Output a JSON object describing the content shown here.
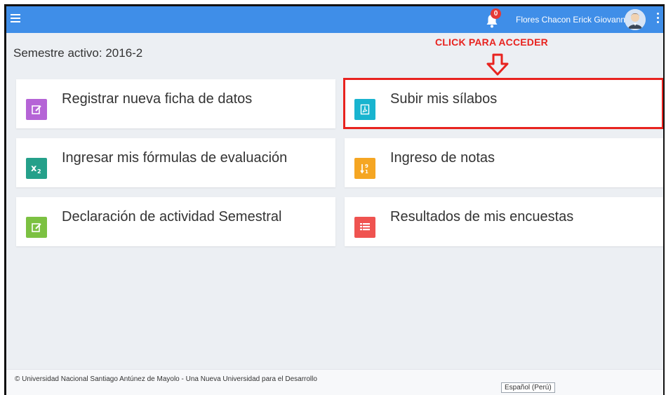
{
  "header": {
    "notifications_count": "0",
    "user_name": "Flores Chacon Erick Giovanny",
    "icons": [
      "menu-icon",
      "bell-icon",
      "avatar",
      "more-vert-icon"
    ],
    "color": "#3f8ee8"
  },
  "main": {
    "semester_label": "Semestre activo: 2016-2",
    "annotation": {
      "text": "CLICK PARA ACCEDER",
      "color": "#e8231f"
    },
    "cards": [
      {
        "label": "Registrar nueva ficha de datos",
        "icon": "edit-icon",
        "color": "#b564d6"
      },
      {
        "label": "Subir mis sílabos",
        "icon": "pdf-icon",
        "color": "#19b4cf"
      },
      {
        "label": "Ingresar mis fórmulas de evaluación",
        "icon": "subscript-icon",
        "color": "#25a08a"
      },
      {
        "label": "Ingreso de notas",
        "icon": "sort-numeric-icon",
        "color": "#f5a623"
      },
      {
        "label": "Declaración de actividad Semestral",
        "icon": "edit-icon",
        "color": "#7cc142"
      },
      {
        "label": "Resultados de mis encuestas",
        "icon": "list-icon",
        "color": "#ef5350"
      }
    ]
  },
  "footer": {
    "text": "© Universidad Nacional Santiago Antúnez de Mayolo - Una Nueva Universidad para el Desarrollo",
    "language": "Español (Perú)"
  }
}
